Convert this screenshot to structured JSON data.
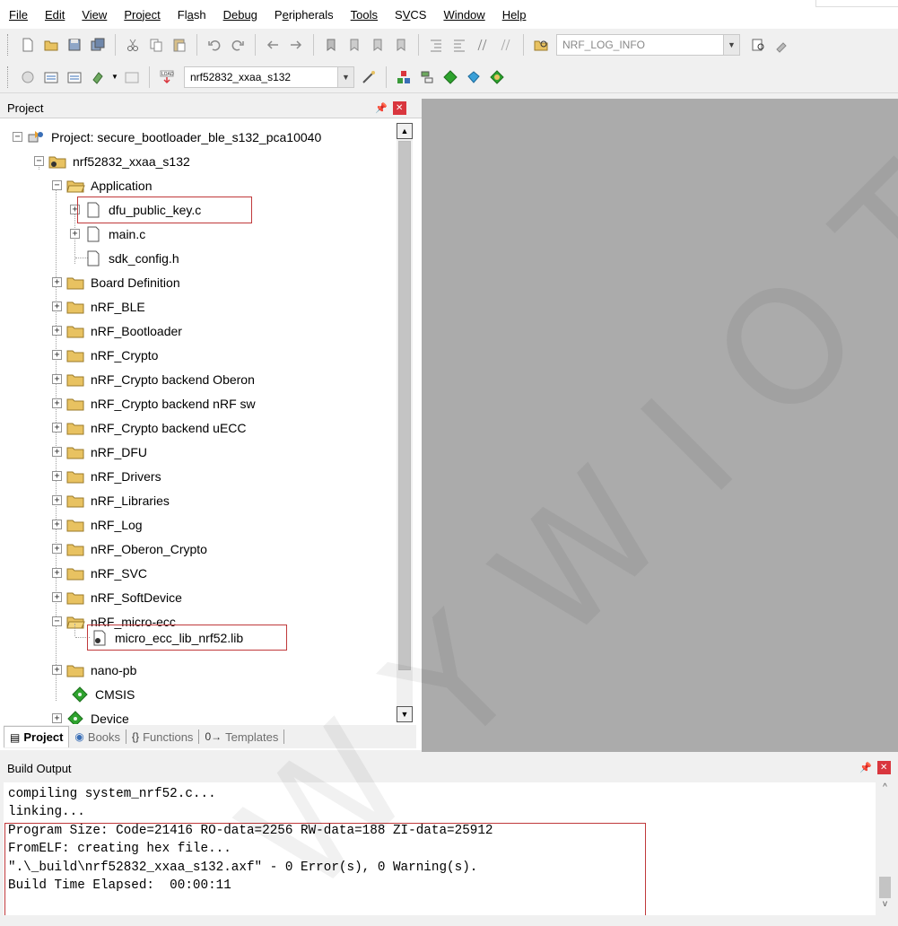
{
  "menu": {
    "items": [
      "File",
      "Edit",
      "View",
      "Project",
      "Flash",
      "Debug",
      "Peripherals",
      "Tools",
      "SVCS",
      "Window",
      "Help"
    ],
    "underline_index": [
      0,
      0,
      0,
      0,
      2,
      0,
      1,
      0,
      1,
      0,
      0
    ]
  },
  "toolbar1": {
    "define_combo": "NRF_LOG_INFO"
  },
  "toolbar2": {
    "target_combo": "nrf52832_xxaa_s132"
  },
  "project_pane": {
    "title": "Project"
  },
  "tree": {
    "root": "Project: secure_bootloader_ble_s132_pca10040",
    "target": "nrf52832_xxaa_s132",
    "application": "Application",
    "app_files": [
      "dfu_public_key.c",
      "main.c",
      "sdk_config.h"
    ],
    "groups": [
      "Board Definition",
      "nRF_BLE",
      "nRF_Bootloader",
      "nRF_Crypto",
      "nRF_Crypto backend Oberon",
      "nRF_Crypto backend nRF sw",
      "nRF_Crypto backend uECC",
      "nRF_DFU",
      "nRF_Drivers",
      "nRF_Libraries",
      "nRF_Log",
      "nRF_Oberon_Crypto",
      "nRF_SVC",
      "nRF_SoftDevice"
    ],
    "micro_ecc_group": "nRF_micro-ecc",
    "micro_ecc_file": "micro_ecc_lib_nrf52.lib",
    "after_groups": [
      "nano-pb"
    ],
    "components": [
      "CMSIS",
      "Device"
    ]
  },
  "tabs": {
    "project": "Project",
    "books": "Books",
    "functions": "Functions",
    "templates": "Templates"
  },
  "build_output": {
    "title": "Build Output",
    "lines": [
      "compiling system_nrf52.c...",
      "linking...",
      "Program Size: Code=21416 RO-data=2256 RW-data=188 ZI-data=25912",
      "FromELF: creating hex file...",
      "\".\\_build\\nrf52832_xxaa_s132.axf\" - 0 Error(s), 0 Warning(s).",
      "Build Time Elapsed:  00:00:11"
    ]
  },
  "watermark": "WYWIOT",
  "colors": {
    "highlight": "#c0393b",
    "editor_bg": "#ababab",
    "close_btn": "#d9363e"
  }
}
